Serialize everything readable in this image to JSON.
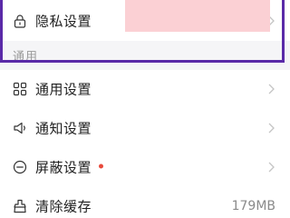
{
  "rows_top": [
    {
      "label": "隐私设置",
      "icon": "lock-icon"
    }
  ],
  "section": {
    "title": "通用"
  },
  "rows": [
    {
      "label": "通用设置",
      "icon": "grid-icon"
    },
    {
      "label": "通知设置",
      "icon": "speaker-icon"
    },
    {
      "label": "屏蔽设置",
      "icon": "block-icon",
      "badge": "red-dot"
    },
    {
      "label": "清除缓存",
      "icon": "broom-icon",
      "value": "179MB"
    }
  ],
  "colors": {
    "frame": "#5a2aa8",
    "badge": "#e84a3c",
    "redaction": "#fbd0d4",
    "section_bg": "#f5f5f7"
  }
}
